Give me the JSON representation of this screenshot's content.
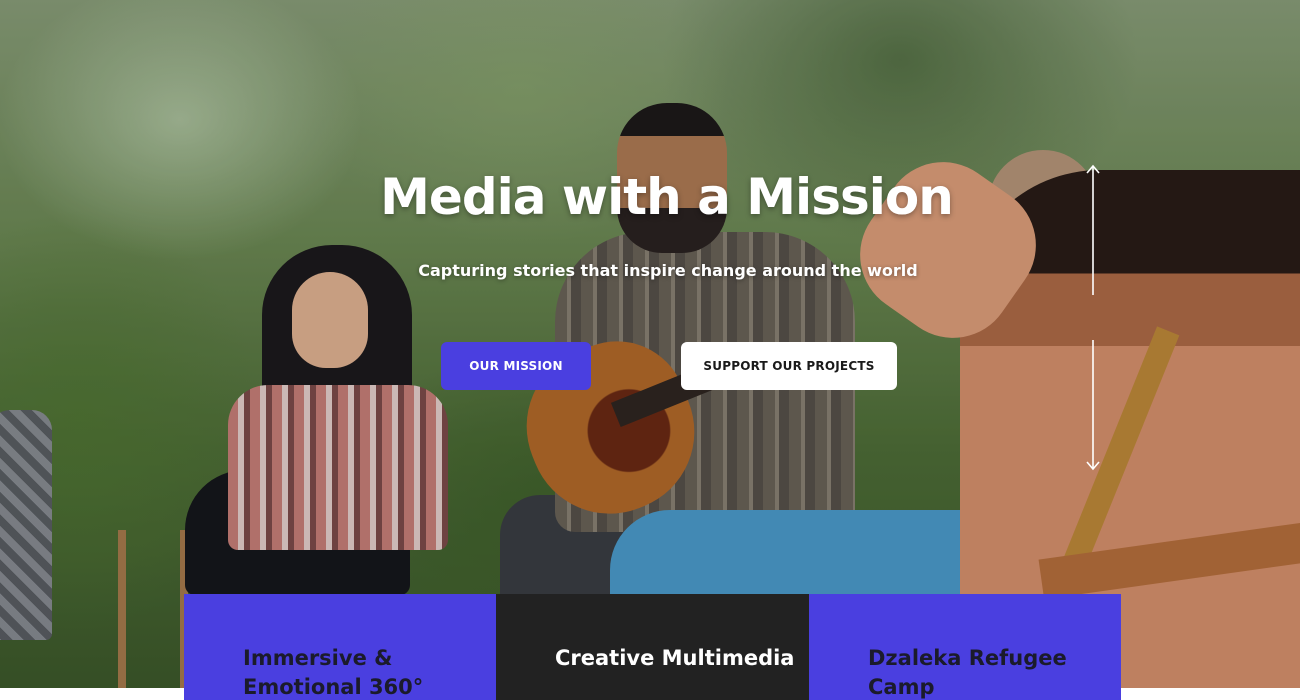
{
  "hero": {
    "title": "Media with a Mission",
    "subtitle": "Capturing stories that inspire change around the world",
    "primary_button": "OUR MISSION",
    "secondary_button": "SUPPORT OUR PROJECTS",
    "image_description_icon": "photo-background"
  },
  "cards": [
    {
      "title": "Immersive & Emotional 360°"
    },
    {
      "title": "Creative Multimedia"
    },
    {
      "title": "Dzaleka Refugee Camp"
    }
  ],
  "colors": {
    "accent": "#4a3fe0",
    "dark": "#222222",
    "white": "#ffffff"
  },
  "icons": {
    "scroll": "scroll-up-down-icon"
  }
}
